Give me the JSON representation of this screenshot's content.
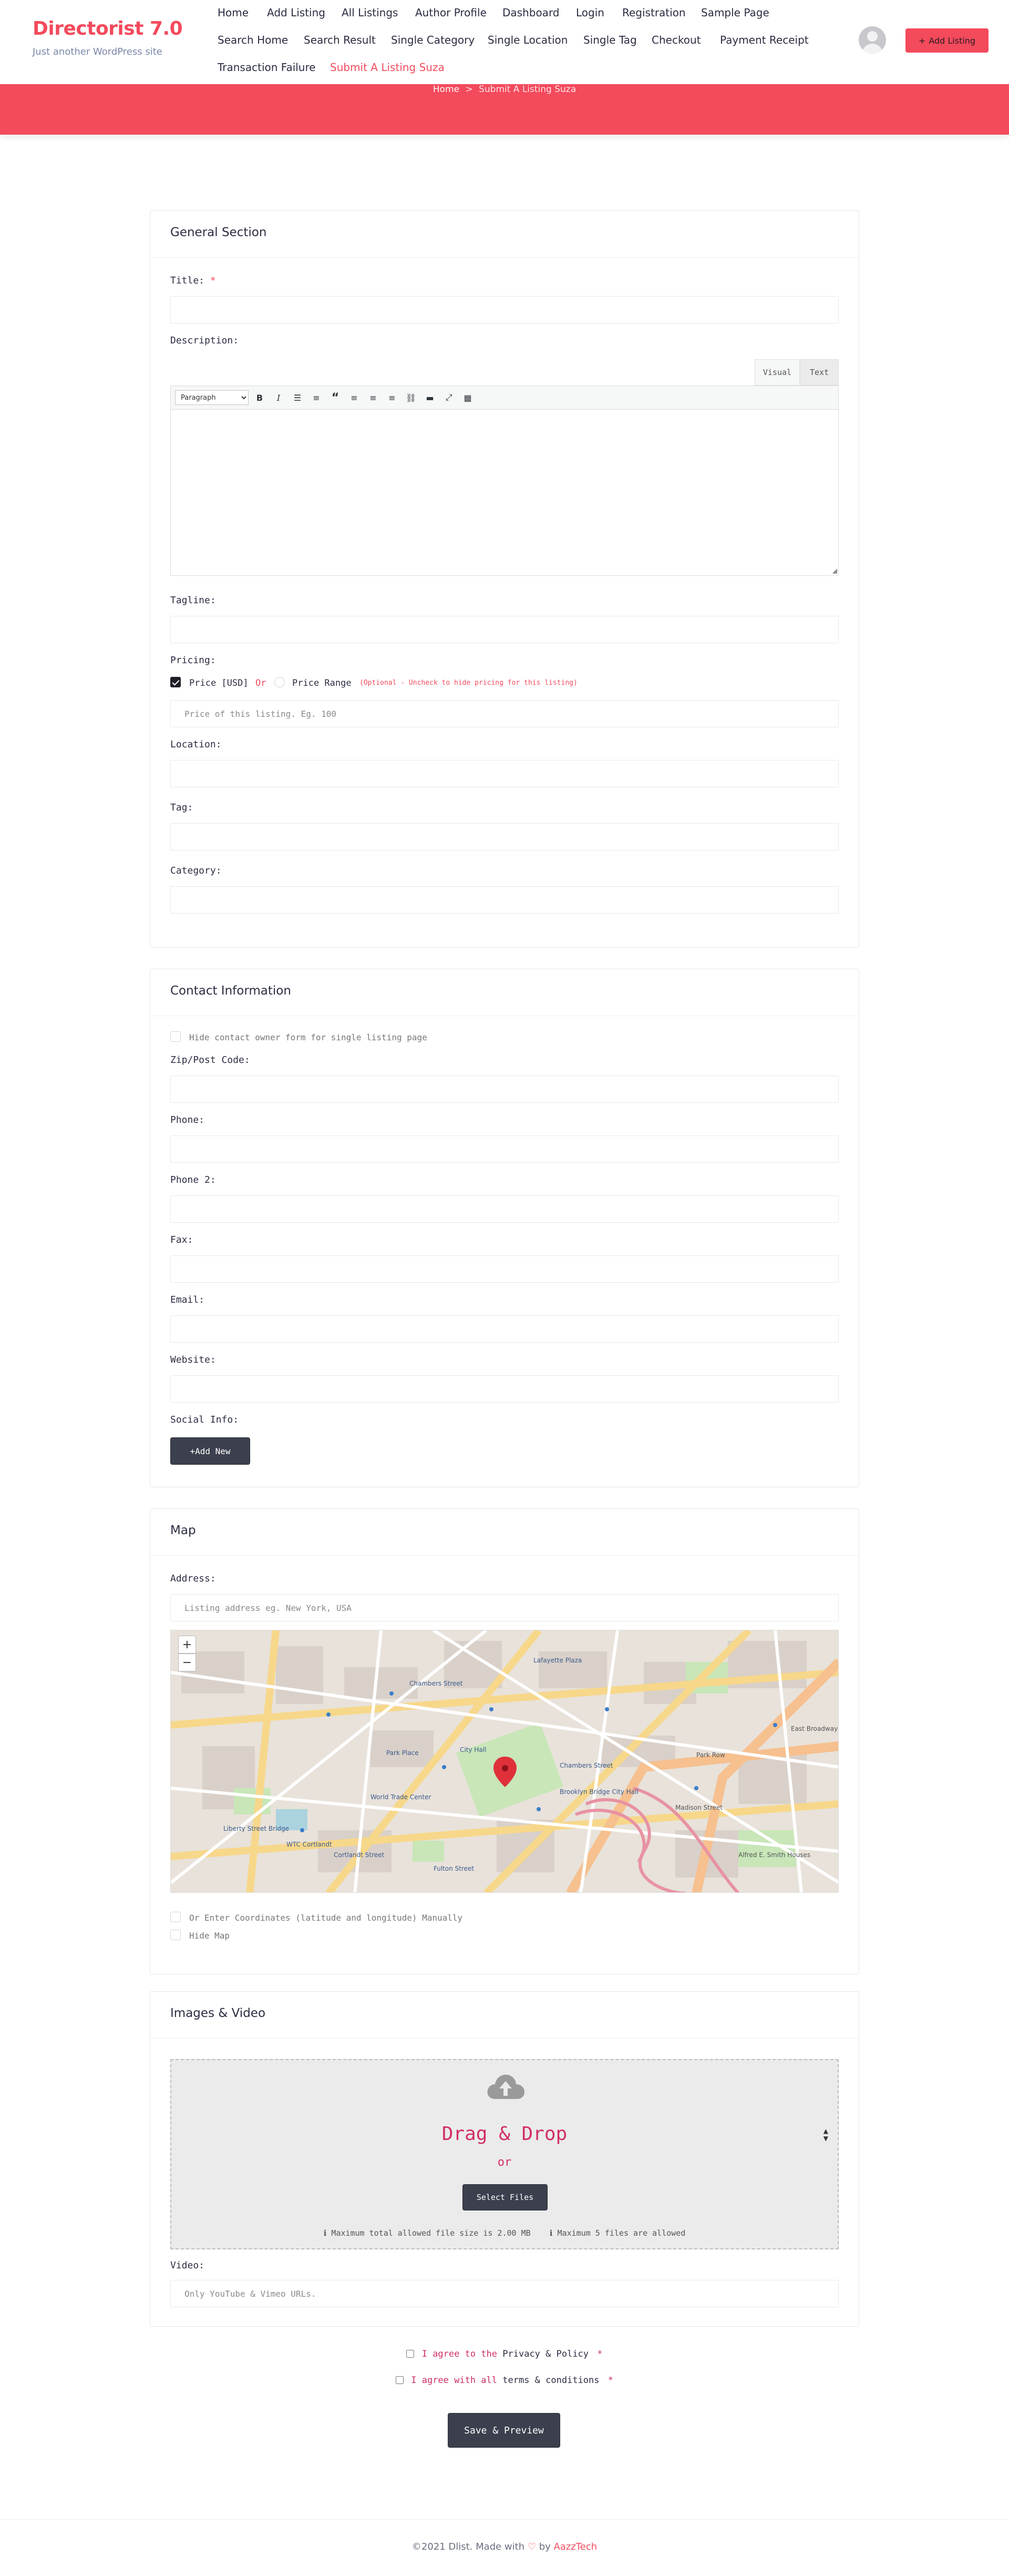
{
  "header": {
    "brand_title": "Directorist 7.0",
    "brand_tagline": "Just another WordPress site",
    "nav": [
      "Home",
      "Add Listing",
      "All Listings",
      "Author Profile",
      "Dashboard",
      "Login",
      "Registration",
      "Sample Page",
      "Search Home",
      "Search Result",
      "Single Category",
      "Single Location",
      "Single Tag",
      "Checkout",
      "Payment Receipt",
      "Transaction Failure",
      "Submit A Listing Suza"
    ],
    "active_nav": "Submit A Listing Suza",
    "add_listing_label": "Add Listing",
    "add_listing_icon": "plus-icon",
    "accent_color": "#f34a5c"
  },
  "breadcrumb": {
    "home": "Home",
    "separator": ">",
    "current": "Submit A Listing Suza"
  },
  "general": {
    "section_title": "General Section",
    "title_label": "Title:",
    "required_mark": "*",
    "description_label": "Description:",
    "editor_tabs": [
      "Visual",
      "Text"
    ],
    "format_value": "Paragraph",
    "tagline_label": "Tagline:",
    "pricing_label": "Pricing:",
    "price_option": "Price [USD]",
    "or_text": "Or",
    "price_range_option": "Price Range",
    "pricing_hint": "(Optional - Uncheck to hide pricing for this listing)",
    "price_placeholder": "Price of this listing. Eg. 100",
    "location_label": "Location:",
    "tag_label": "Tag:",
    "category_label": "Category:"
  },
  "contact": {
    "section_title": "Contact Information",
    "hide_form_label": "Hide contact owner form for single listing page",
    "zip_label": "Zip/Post Code:",
    "phone_label": "Phone:",
    "phone2_label": "Phone 2:",
    "fax_label": "Fax:",
    "email_label": "Email:",
    "website_label": "Website:",
    "social_label": "Social Info:",
    "add_new_label": "+Add New"
  },
  "map": {
    "section_title": "Map",
    "address_label": "Address:",
    "address_placeholder": "Listing address eg. New York, USA",
    "zoom_in": "+",
    "zoom_out": "−",
    "labels": [
      "Chambers Street",
      "Lafayette Plaza",
      "City Hall",
      "Park Place",
      "Brooklyn Bridge City Hall",
      "Chambers Street",
      "World Trade Center",
      "WTC Cortlandt",
      "Cortlandt Street",
      "Fulton Street",
      "Liberty Street Bridge",
      "Madison Street",
      "Park Row",
      "East Broadway",
      "Alfred E. Smith Houses"
    ],
    "manual_coords_label": "Or Enter Coordinates (latitude and longitude) Manually",
    "hide_map_label": "Hide Map"
  },
  "media": {
    "section_title": "Images & Video",
    "drop_title": "Drag & Drop",
    "drop_or": "or",
    "select_files_label": "Select Files",
    "max_size_note": "Maximum total allowed file size is 2.00 MB",
    "max_files_note": "Maximum 5 files are allowed",
    "video_label": "Video:",
    "video_placeholder": "Only YouTube & Vimeo URLs."
  },
  "agreements": {
    "privacy_prefix": "I agree to the",
    "privacy_link": "Privacy & Policy",
    "terms_prefix": "I agree with all",
    "terms_link": "terms & conditions",
    "required_mark": "*"
  },
  "submit_label": "Save & Preview",
  "footer": {
    "text": "©2021 Dlist. Made with",
    "by": "by",
    "brand": "AazzTech"
  }
}
